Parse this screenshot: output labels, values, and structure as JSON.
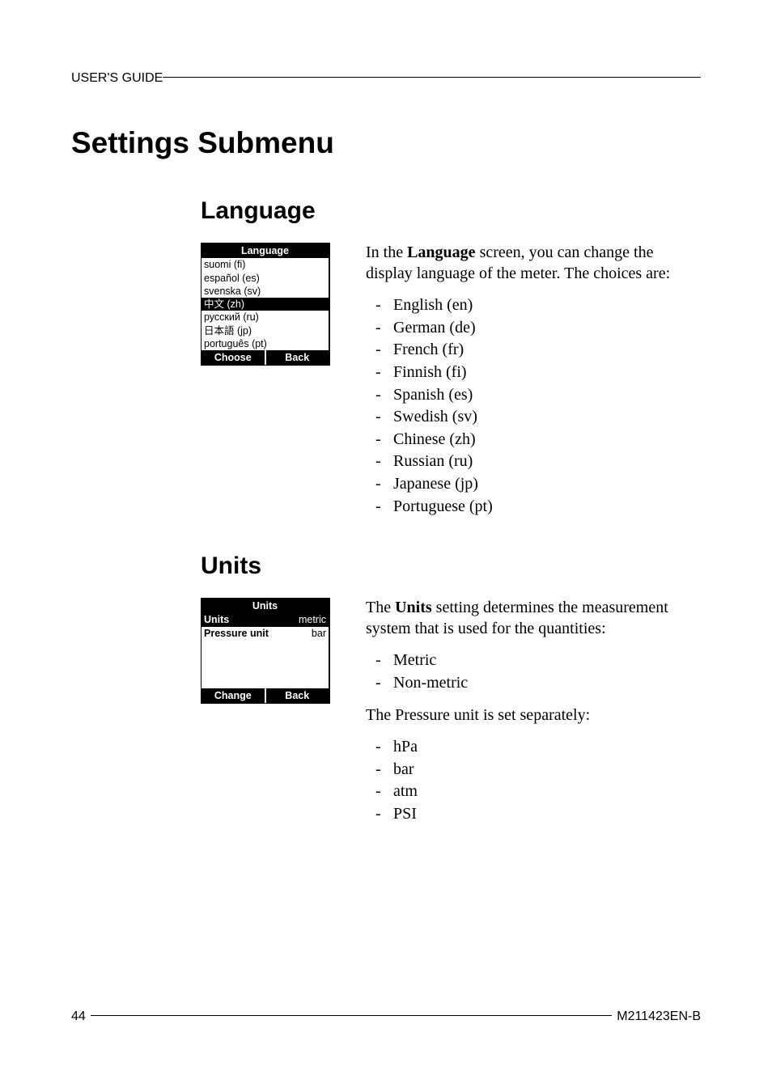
{
  "header": {
    "title": "USER'S GUIDE"
  },
  "section": {
    "title": "Settings Submenu"
  },
  "language": {
    "heading": "Language",
    "screenshot": {
      "title": "Language",
      "items": [
        {
          "label": "suomi (fi)",
          "selected": false
        },
        {
          "label": "español (es)",
          "selected": false
        },
        {
          "label": "svenska (sv)",
          "selected": false
        },
        {
          "label": "中文 (zh)",
          "selected": true
        },
        {
          "label": "русский (ru)",
          "selected": false
        },
        {
          "label": "日本語 (jp)",
          "selected": false
        },
        {
          "label": "português (pt)",
          "selected": false
        }
      ],
      "soft_left": "Choose",
      "soft_right": "Back"
    },
    "para_prefix": "In the ",
    "para_bold": "Language",
    "para_suffix": " screen, you can change the display language of the meter. The choices are:",
    "list": [
      "English (en)",
      "German (de)",
      "French (fr)",
      "Finnish (fi)",
      "Spanish (es)",
      "Swedish (sv)",
      "Chinese (zh)",
      "Russian (ru)",
      "Japanese (jp)",
      "Portuguese (pt)"
    ]
  },
  "units": {
    "heading": "Units",
    "screenshot": {
      "title": "Units",
      "rows": [
        {
          "label": "Units",
          "value": "metric",
          "selected": true
        },
        {
          "label": "Pressure unit",
          "value": "bar",
          "selected": false
        }
      ],
      "soft_left": "Change",
      "soft_right": "Back"
    },
    "para1_prefix": "The ",
    "para1_bold": "Units",
    "para1_suffix": " setting determines the measurement system that is used for the quantities:",
    "list1": [
      "Metric",
      "Non-metric"
    ],
    "para2": "The Pressure unit is set separately:",
    "list2": [
      "hPa",
      "bar",
      "atm",
      "PSI"
    ]
  },
  "footer": {
    "page": "44",
    "doc_id": "M211423EN-B"
  }
}
